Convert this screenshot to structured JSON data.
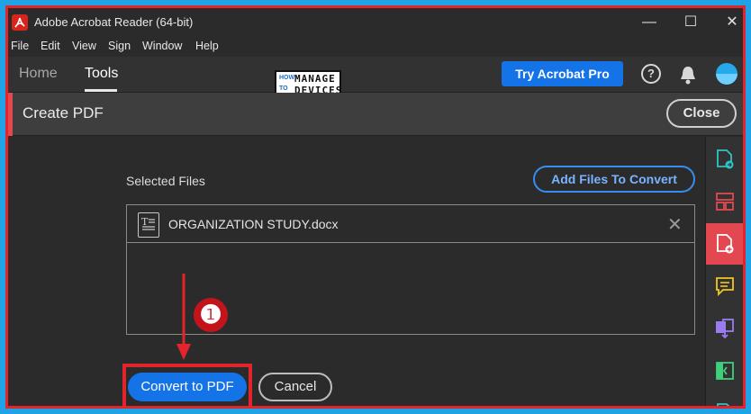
{
  "window": {
    "title": "Adobe Acrobat Reader (64-bit)",
    "controls": {
      "minimize": "—",
      "maximize": "☐",
      "close": "✕"
    }
  },
  "menu": {
    "items": [
      "File",
      "Edit",
      "View",
      "Sign",
      "Window",
      "Help"
    ]
  },
  "nav": {
    "home_label": "Home",
    "tools_label": "Tools",
    "active_tab": "Tools",
    "try_pro_label": "Try Acrobat Pro",
    "help_glyph": "?"
  },
  "brand_logo": {
    "line1": "HOW",
    "line2": "TO",
    "line3": "MANAGE",
    "line4": "DEVICES"
  },
  "tool_header": {
    "title": "Create PDF",
    "close_label": "Close"
  },
  "files": {
    "section_label": "Selected Files",
    "add_button_label": "Add Files To Convert",
    "items": [
      {
        "name": "ORGANIZATION STUDY.docx",
        "icon": "word-document-icon"
      }
    ],
    "remove_glyph": "✕"
  },
  "actions": {
    "convert_label": "Convert to PDF",
    "cancel_label": "Cancel"
  },
  "annotation": {
    "step_number": "❶"
  },
  "right_rail": {
    "icons": [
      "export-pdf-icon",
      "organize-pages-icon",
      "create-pdf-icon",
      "comment-icon",
      "combine-files-icon",
      "compress-icon",
      "more-tools-icon"
    ],
    "active_icon": "create-pdf-icon"
  },
  "colors": {
    "accent_blue": "#1473e6",
    "tool_accent": "#e34850",
    "annotation_red": "#e3242b",
    "rail_teal": "#2ec4c4",
    "rail_purple": "#9a7cf0",
    "rail_yellow": "#f3c620",
    "rail_green": "#3fd07c"
  }
}
